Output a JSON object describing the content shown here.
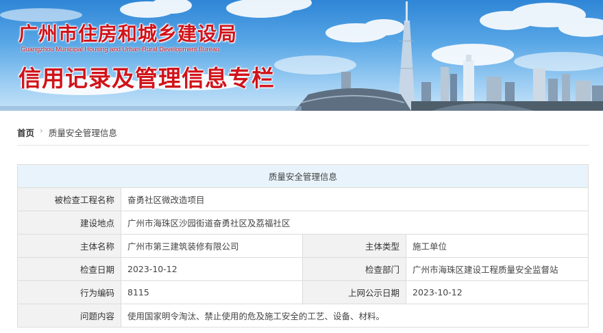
{
  "banner": {
    "title_cn": "广州市住房和城乡建设局",
    "title_en": "Guangzhou Municipal Housing and Urban-Rural Development Bureau",
    "subtitle": "信用记录及管理信息专栏"
  },
  "breadcrumb": {
    "home": "首页",
    "separator": "›",
    "current": "质量安全管理信息"
  },
  "table": {
    "caption": "质量安全管理信息",
    "project_label": "被检查工程名称",
    "project_value": "奋勇社区微改造项目",
    "location_label": "建设地点",
    "location_value": "广州市海珠区沙园街道奋勇社区及荔福社区",
    "entity_label": "主体名称",
    "entity_value": "广州市第三建筑装修有限公司",
    "entity_type_label": "主体类型",
    "entity_type_value": "施工单位",
    "check_date_label": "检查日期",
    "check_date_value": "2023-10-12",
    "check_dept_label": "检查部门",
    "check_dept_value": "广州市海珠区建设工程质量安全监督站",
    "code_label": "行为编码",
    "code_value": "8115",
    "publish_date_label": "上网公示日期",
    "publish_date_value": "2023-10-12",
    "problem_label": "问题内容",
    "problem_value": "使用国家明令淘汰、禁止使用的危及施工安全的工艺、设备、材料。"
  },
  "colors": {
    "title_red": "#d0131a",
    "table_header_bg": "#e8f3fb",
    "label_bg": "#f2f2f2",
    "border": "#dcdcdc"
  }
}
